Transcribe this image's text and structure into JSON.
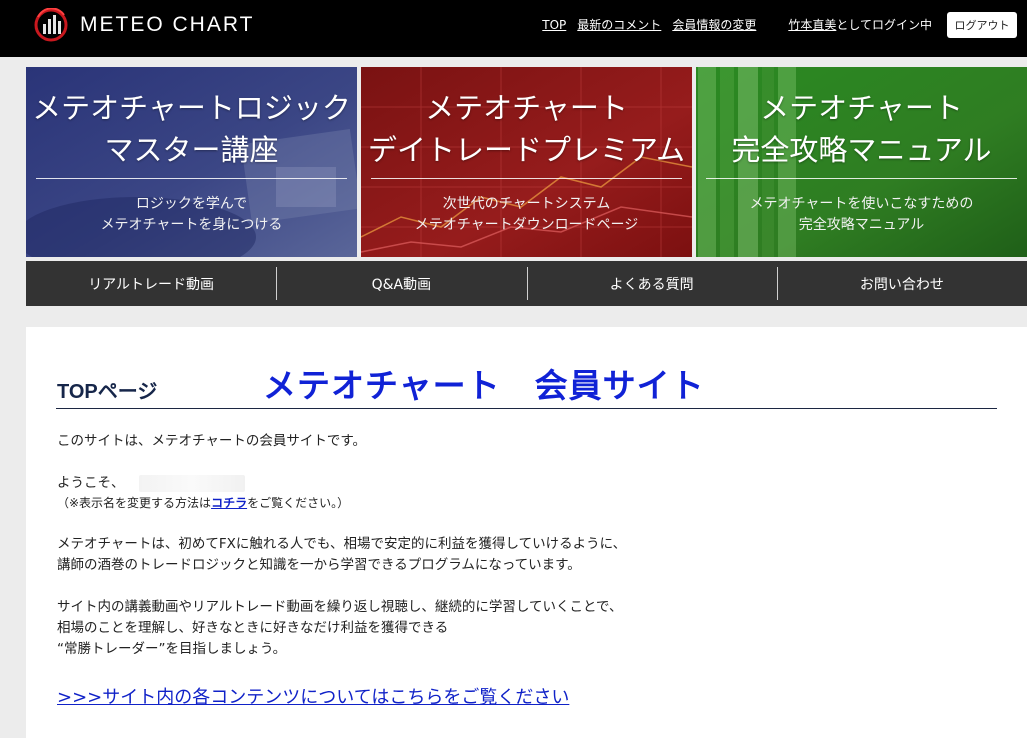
{
  "header": {
    "logo_text": "METEO CHART",
    "nav": {
      "top": "TOP",
      "latest_comments": "最新のコメント",
      "member_info": "会員情報の変更"
    },
    "login": {
      "user_name": "竹本直美",
      "suffix": "としてログイン中"
    },
    "logout_label": "ログアウト"
  },
  "banners": [
    {
      "title_lines": [
        "メテオチャートロジック",
        "マスター講座"
      ],
      "sub_lines": [
        "ロジックを学んで",
        "メテオチャートを身につける"
      ],
      "color": "#27306b"
    },
    {
      "title_lines": [
        "メテオチャート",
        "デイトレードプレミアム"
      ],
      "sub_lines": [
        "次世代のチャートシステム",
        "メテオチャートダウンロードページ"
      ],
      "color": "#8b1919"
    },
    {
      "title_lines": [
        "メテオチャート",
        "完全攻略マニュアル"
      ],
      "sub_lines": [
        "メテオチャートを使いこなすための",
        "完全攻略マニュアル"
      ],
      "color": "#2f7d22"
    }
  ],
  "sub_nav": [
    "リアルトレード動画",
    "Q&A動画",
    "よくある質問",
    "お問い合わせ"
  ],
  "main": {
    "page_title": "TOPページ",
    "site_title": "メテオチャート　会員サイト",
    "intro": "このサイトは、メテオチャートの会員サイトです。",
    "welcome": "ようこそ、",
    "note_prefix": "（※表示名を変更する方法は",
    "note_link": "コチラ",
    "note_suffix": "をご覧ください。）",
    "para1": [
      "メテオチャートは、初めてFXに触れる人でも、相場で安定的に利益を獲得していけるように、",
      "講師の酒巻のトレードロジックと知識を一から学習できるプログラムになっています。"
    ],
    "para2": [
      "サイト内の講義動画やリアルトレード動画を繰り返し視聴し、継続的に学習していくことで、",
      "相場のことを理解し、好きなときに好きなだけ利益を獲得できる",
      "“常勝トレーダー”を目指しましょう。"
    ],
    "content_link": ">>>サイト内の各コンテンツについてはこちらをご覧ください"
  },
  "colors": {
    "header_bg": "#000000",
    "sub_nav_bg": "#333333",
    "link": "#1022c8",
    "site_title": "#1022d6",
    "page_title": "#16264a"
  }
}
